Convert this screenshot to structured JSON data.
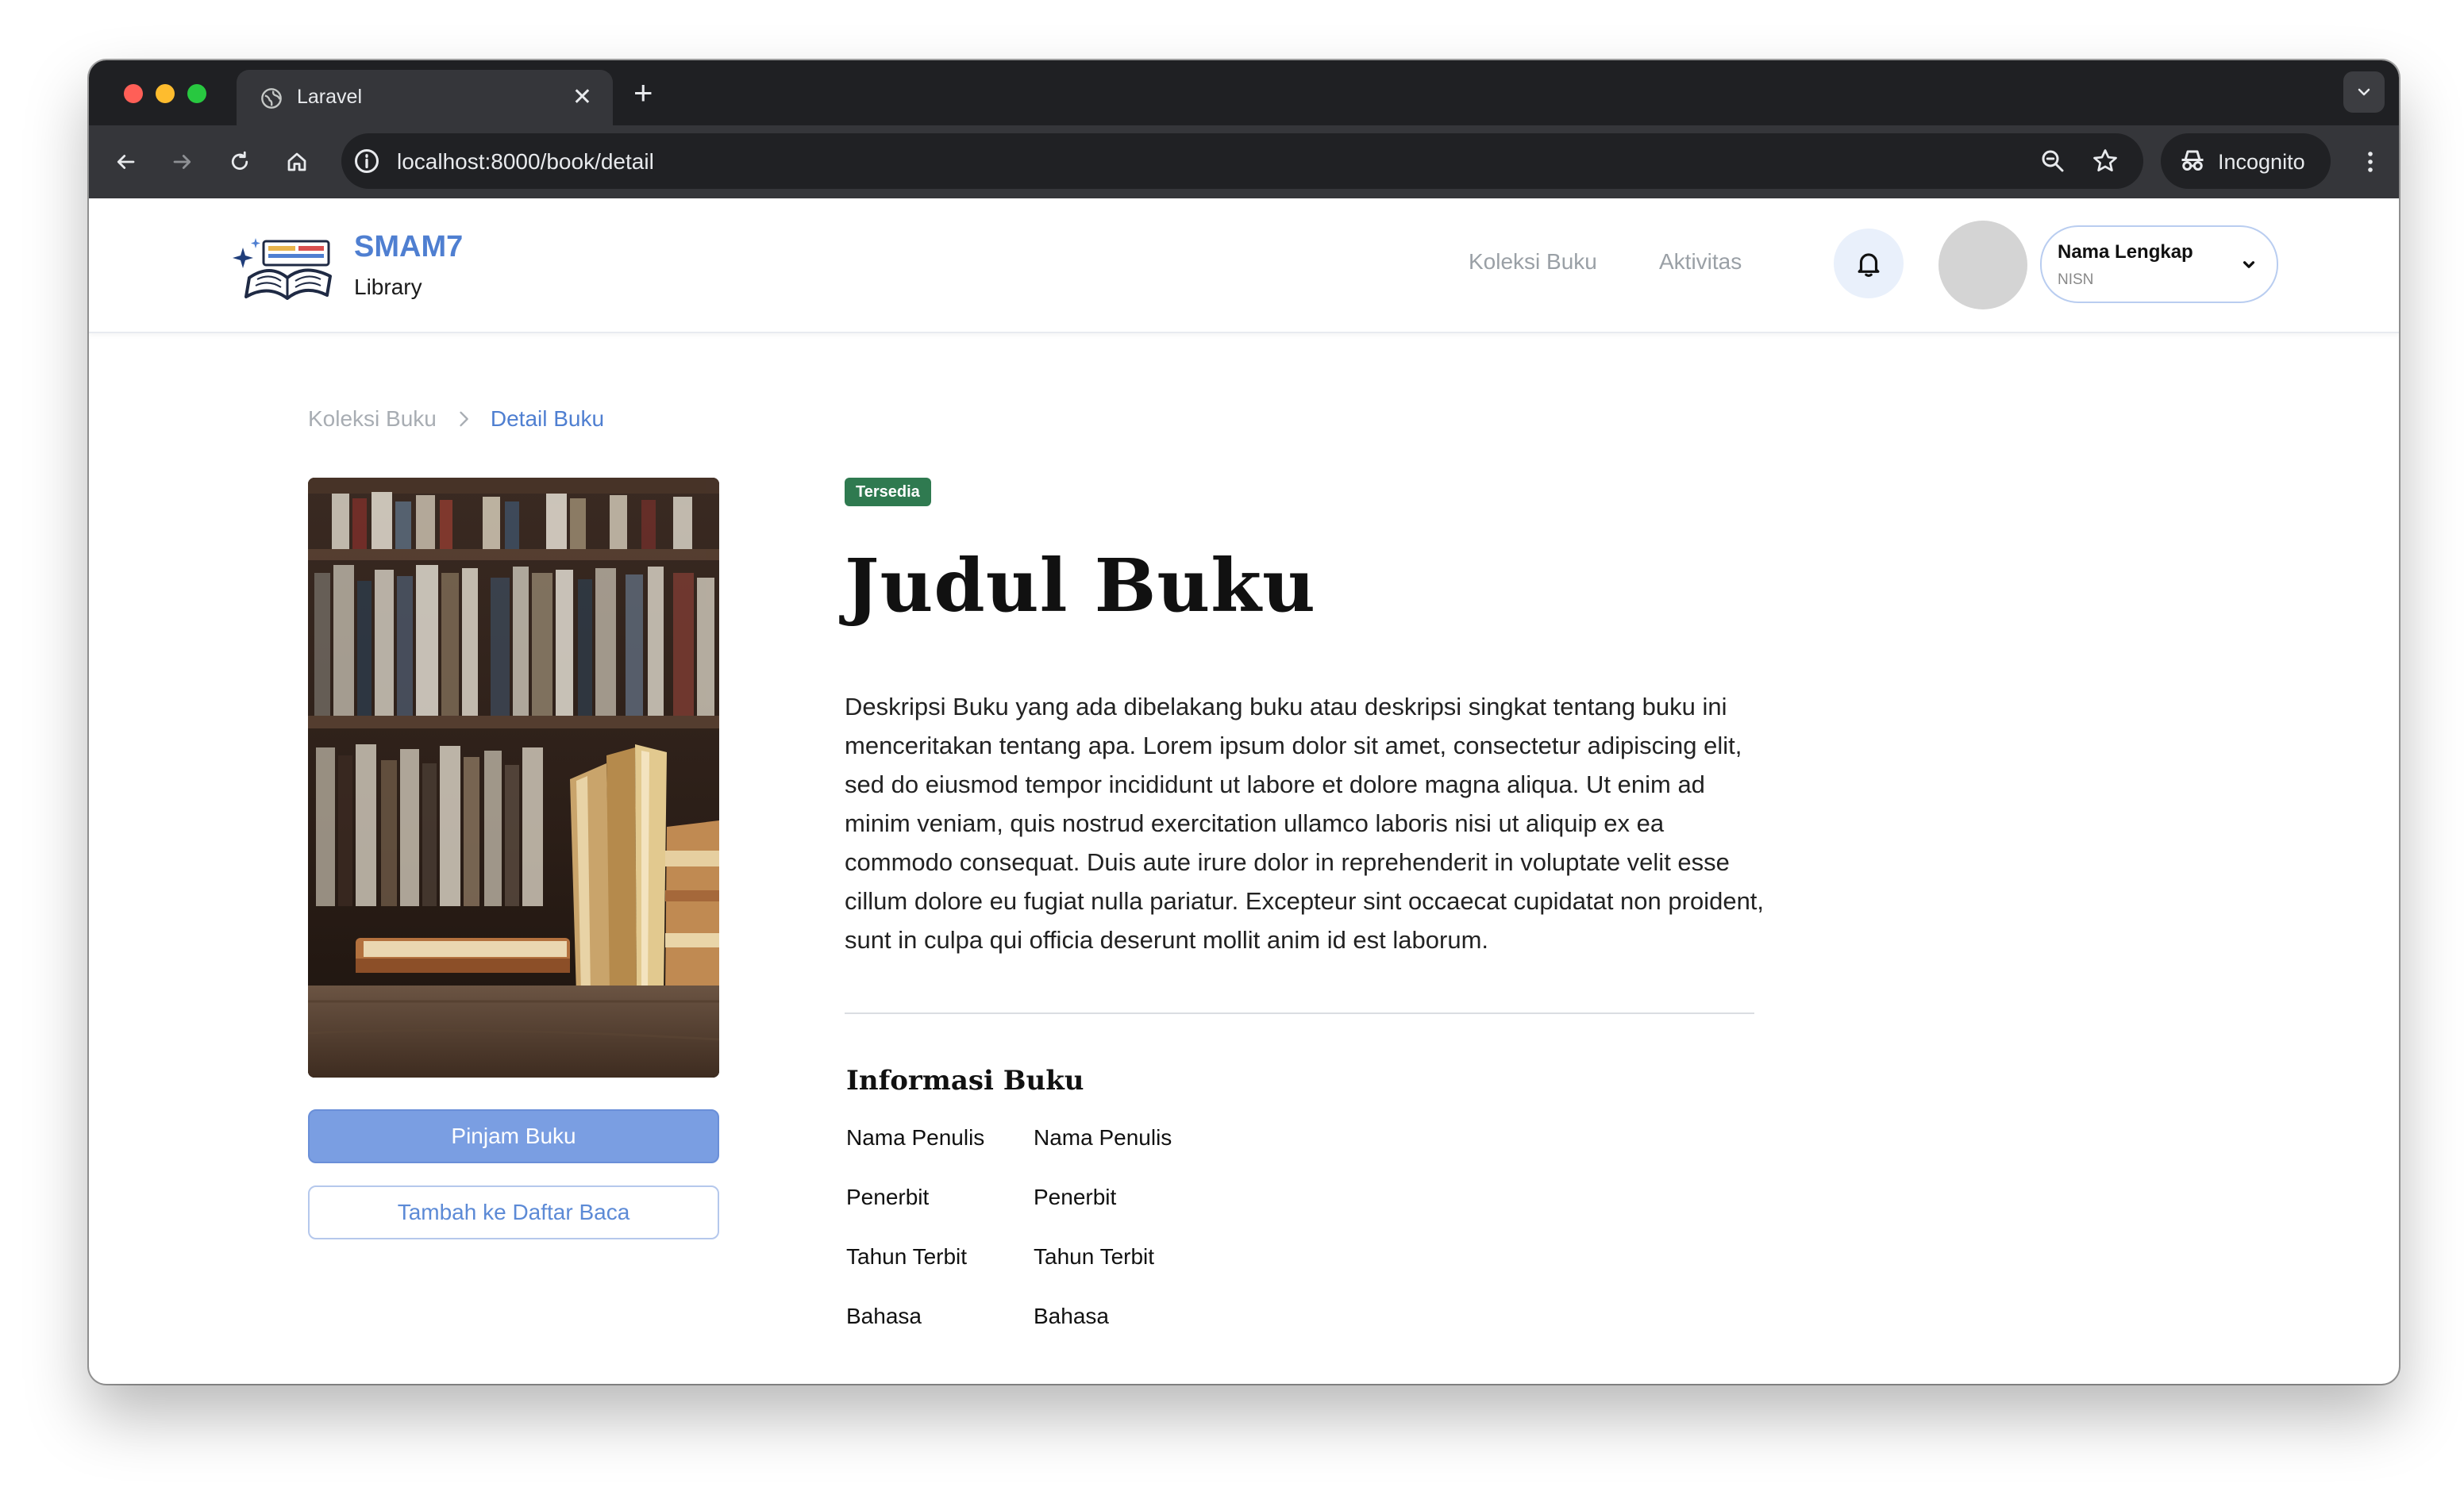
{
  "browser": {
    "tab_title": "Laravel",
    "url": "localhost:8000/book/detail",
    "incognito_label": "Incognito"
  },
  "header": {
    "brand_title": "SMAM7",
    "brand_sub": "Library",
    "nav": {
      "koleksi": "Koleksi Buku",
      "aktivitas": "Aktivitas"
    },
    "profile": {
      "name": "Nama Lengkap",
      "nisn": "NISN"
    }
  },
  "breadcrumb": {
    "parent": "Koleksi Buku",
    "current": "Detail Buku"
  },
  "actions": {
    "borrow": "Pinjam Buku",
    "add_to_list": "Tambah ke Daftar Baca"
  },
  "book": {
    "status": "Tersedia",
    "title": "Judul Buku",
    "description": "Deskripsi Buku yang ada dibelakang buku atau deskripsi singkat tentang buku ini menceritakan tentang apa. Lorem ipsum dolor sit amet, consectetur adipiscing elit, sed do eiusmod tempor incididunt ut labore et dolore magna aliqua. Ut enim ad minim veniam, quis nostrud exercitation ullamco laboris nisi ut aliquip ex ea commodo consequat. Duis aute irure dolor in reprehenderit in voluptate velit esse cillum dolore eu fugiat nulla pariatur. Excepteur sint occaecat cupidatat non proident, sunt in culpa qui officia deserunt mollit anim id est laborum.",
    "info_title": "Informasi Buku",
    "info": [
      {
        "label": "Nama Penulis",
        "value": "Nama Penulis"
      },
      {
        "label": "Penerbit",
        "value": "Penerbit"
      },
      {
        "label": "Tahun Terbit",
        "value": "Tahun Terbit"
      },
      {
        "label": "Bahasa",
        "value": "Bahasa"
      }
    ]
  },
  "colors": {
    "accent": "#4f7fd1",
    "button": "#7a9ee2",
    "badge": "#2f7a50"
  },
  "icons": [
    "globe-icon",
    "close-icon",
    "plus-icon",
    "chevron-down-icon",
    "back-icon",
    "forward-icon",
    "reload-icon",
    "home-icon",
    "info-icon",
    "zoom-icon",
    "star-icon",
    "incognito-icon",
    "kebab-icon",
    "bell-icon",
    "chevron-right-icon"
  ]
}
